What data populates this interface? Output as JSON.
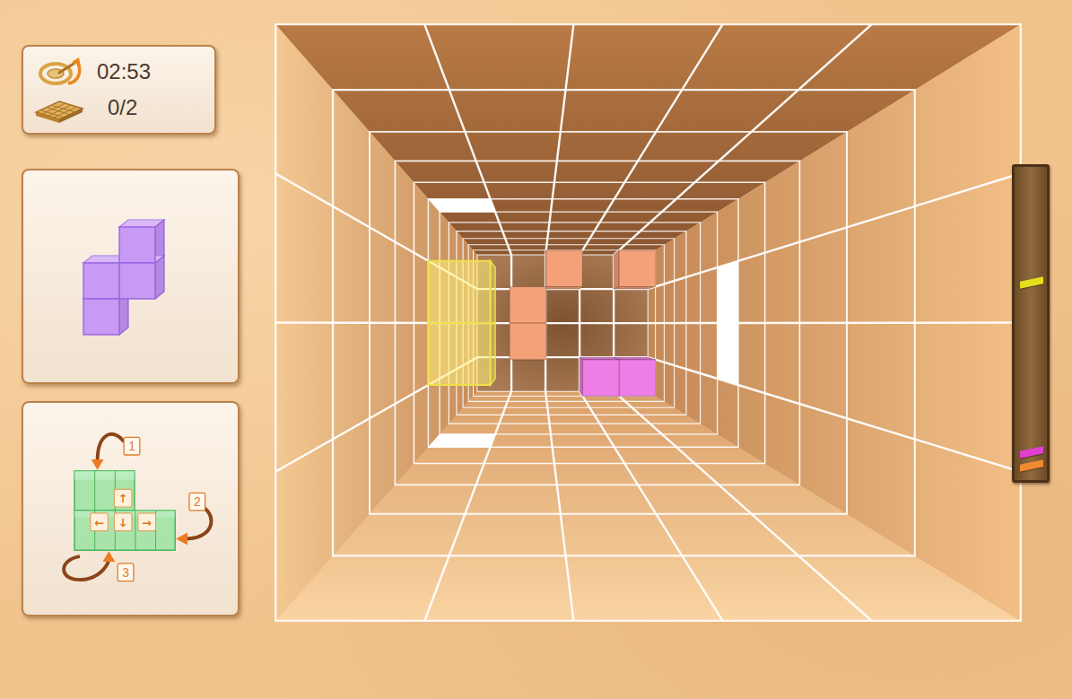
{
  "hud": {
    "timer": "02:53",
    "layers": "0/2"
  },
  "next_piece": {
    "color": "#c79af5",
    "cells": [
      {
        "col": 1,
        "row": 0
      },
      {
        "col": 0,
        "row": 1
      },
      {
        "col": 1,
        "row": 1
      },
      {
        "col": 0,
        "row": 2
      }
    ]
  },
  "controls": {
    "rotations": [
      {
        "label": "1"
      },
      {
        "label": "2"
      },
      {
        "label": "3"
      }
    ],
    "keys": [
      {
        "label": "↑"
      },
      {
        "label": "←"
      },
      {
        "label": "↓"
      },
      {
        "label": "→"
      }
    ]
  },
  "pit": {
    "columns": 5,
    "rows": 4,
    "depth": 12,
    "falling": {
      "color": "#fff27a",
      "cells": [
        {
          "col": 0,
          "row": 1,
          "layer": 5
        },
        {
          "col": 0,
          "row": 2,
          "layer": 5
        }
      ]
    },
    "stack": [
      {
        "col": 2,
        "row": 0,
        "layer": 11,
        "color": "#f4a078"
      },
      {
        "col": 4,
        "row": 0,
        "layer": 11,
        "color": "#f4a078"
      },
      {
        "col": 1,
        "row": 1,
        "layer": 11,
        "color": "#f4a078"
      },
      {
        "col": 1,
        "row": 2,
        "layer": 11,
        "color": "#f4a078"
      },
      {
        "col": 3,
        "row": 3,
        "layer": 11,
        "color": "#ee7ee6"
      },
      {
        "col": 4,
        "row": 3,
        "layer": 11,
        "color": "#ee7ee6"
      }
    ]
  },
  "depth_meter": {
    "markers": [
      {
        "color": "#e4de1e",
        "level": 0.63
      },
      {
        "color": "#e040d0",
        "level": 0.09
      },
      {
        "color": "#f08a30",
        "level": 0.045
      }
    ]
  }
}
